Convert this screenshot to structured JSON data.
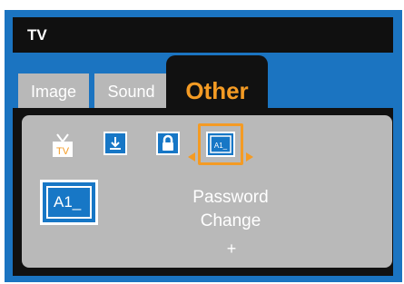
{
  "header": {
    "title": "TV"
  },
  "tabs": [
    {
      "label": "Image",
      "active": false
    },
    {
      "label": "Sound",
      "active": false
    },
    {
      "label": "Other",
      "active": true
    }
  ],
  "icons": [
    {
      "name": "tv-antenna-icon",
      "label": "TV"
    },
    {
      "name": "download-icon"
    },
    {
      "name": "lock-icon"
    },
    {
      "name": "password-icon",
      "label": "A1_",
      "selected": true
    }
  ],
  "selected_item": {
    "icon_label": "A1_",
    "description_line1": "Password",
    "description_line2": "Change",
    "expand_symbol": "+"
  },
  "colors": {
    "frame_blue": "#1b74c1",
    "accent_orange": "#f49b24",
    "panel_gray": "#b9b9b9",
    "tab_gray": "#b8b8b8"
  }
}
